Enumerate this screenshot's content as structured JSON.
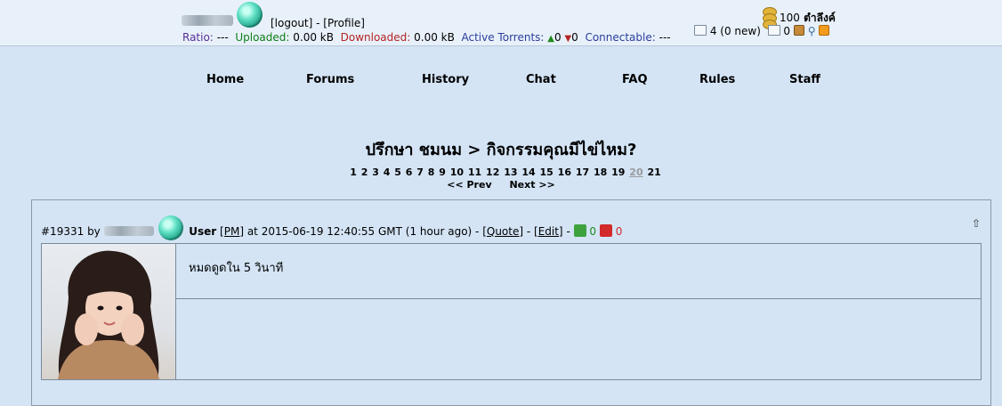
{
  "header": {
    "logout_label": "[logout]",
    "separator": " - ",
    "profile_label": "[Profile]",
    "ratio_label": "Ratio:",
    "ratio_value": "---",
    "uploaded_label": "Uploaded:",
    "uploaded_value": "0.00 kB",
    "downloaded_label": "Downloaded:",
    "downloaded_value": "0.00 kB",
    "active_torrents_label": "Active Torrents:",
    "seeding_count": "0",
    "leeching_count": "0",
    "connectable_label": "Connectable:",
    "connectable_value": "---",
    "points_value": "100",
    "points_unit": "ตำลึงค์",
    "inbox_count": "4",
    "inbox_new": "(0 new)",
    "sent_count": "0"
  },
  "nav": {
    "items": [
      "Home",
      "Forums",
      "History",
      "Chat",
      "FAQ",
      "Rules",
      "Staff"
    ]
  },
  "topic": {
    "title": "ปรึกษา ชมนม > กิจกรรมคุณมีไข่ไหม?",
    "pages": [
      "1",
      "2",
      "3",
      "4",
      "5",
      "6",
      "7",
      "8",
      "9",
      "10",
      "11",
      "12",
      "13",
      "14",
      "15",
      "16",
      "17",
      "18",
      "19",
      "20",
      "21"
    ],
    "current_page": "20",
    "prev_label": "<< Prev",
    "next_label": "Next >>"
  },
  "post": {
    "id": "#19331",
    "by_label": "by",
    "user_class": "User",
    "pm_label": "[PM]",
    "at_label": "at",
    "timestamp": "2015-06-19 12:40:55 GMT",
    "relative": "(1 hour ago)",
    "quote_label": "[Quote]",
    "edit_label": "[Edit]",
    "likes": "0",
    "dislikes": "0",
    "body": "หมดดูดใน 5 วินาที"
  },
  "icons": {
    "rank_badge": "diamond-icon",
    "points": "coin-stack-icon",
    "inbox": "envelope-icon",
    "sentbox": "outbox-icon",
    "rss": "rss-icon",
    "top": "up-arrow-icon"
  },
  "colors": {
    "background": "#d4e4f5",
    "topbar": "#e8f1fa",
    "uploaded": "#0f7d17",
    "downloaded": "#b52323",
    "active_torrents": "#2b3d9d"
  }
}
